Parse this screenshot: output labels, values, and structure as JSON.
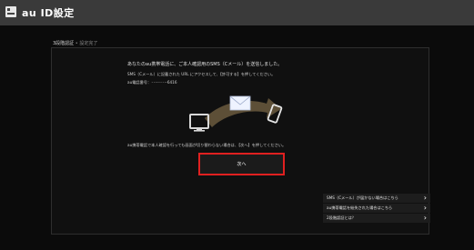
{
  "app": {
    "title": "au ID設定",
    "icon": "settings-card-icon"
  },
  "steps": {
    "current": "3段階認証",
    "separator": "•",
    "next": "設定完了"
  },
  "message": {
    "line1": "あなたのau携帯電話に、ご本人確認用のSMS（Cメール）を送信しました。",
    "line2": "SMS（Cメール）に記載された URL にアクセスして、【許可する】を押してください。",
    "line3": "au電話番号：･･･-････-6416",
    "line4": "au携帯電話で本人確認を行っても画面が切り替わらない場合は、【次へ】を押してください。"
  },
  "illustration": {
    "icons": [
      "monitor-icon",
      "envelope-icon",
      "arrow-icon",
      "phone-icon"
    ]
  },
  "next_button": {
    "label": "次へ",
    "highlight_color": "#e02020"
  },
  "links": [
    {
      "label": "SMS（Cメール）が届かない場合はこちら"
    },
    {
      "label": "au携帯電話を紛失された場合はこちら"
    },
    {
      "label": "2段階認証とは？"
    }
  ]
}
